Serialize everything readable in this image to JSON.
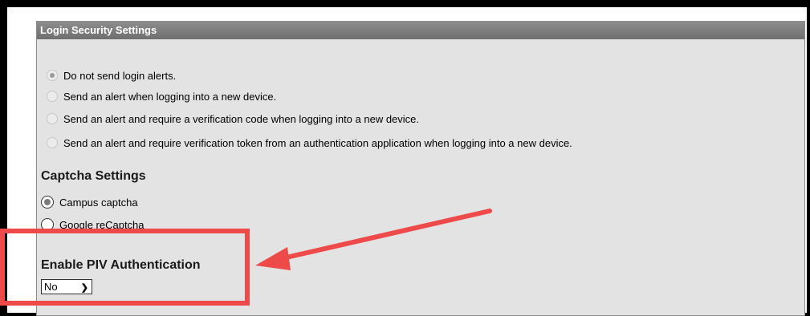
{
  "panel": {
    "title": "Login Security Settings"
  },
  "login_alerts": {
    "selected_index": 0,
    "options": [
      {
        "label": "Do not send login alerts."
      },
      {
        "label": "Send an alert when logging into a new device."
      },
      {
        "label": "Send an alert and require a verification code when logging into a new device."
      },
      {
        "label": "Send an alert and require verification token from an authentication application when logging into a new device."
      }
    ]
  },
  "captcha": {
    "title": "Captcha Settings",
    "selected_index": 0,
    "options": [
      {
        "label": "Campus captcha"
      },
      {
        "label": "Google reCaptcha"
      }
    ]
  },
  "piv": {
    "title": "Enable PIV Authentication",
    "selected_value": "No"
  },
  "annotation": {
    "color": "#ee4a4a"
  }
}
